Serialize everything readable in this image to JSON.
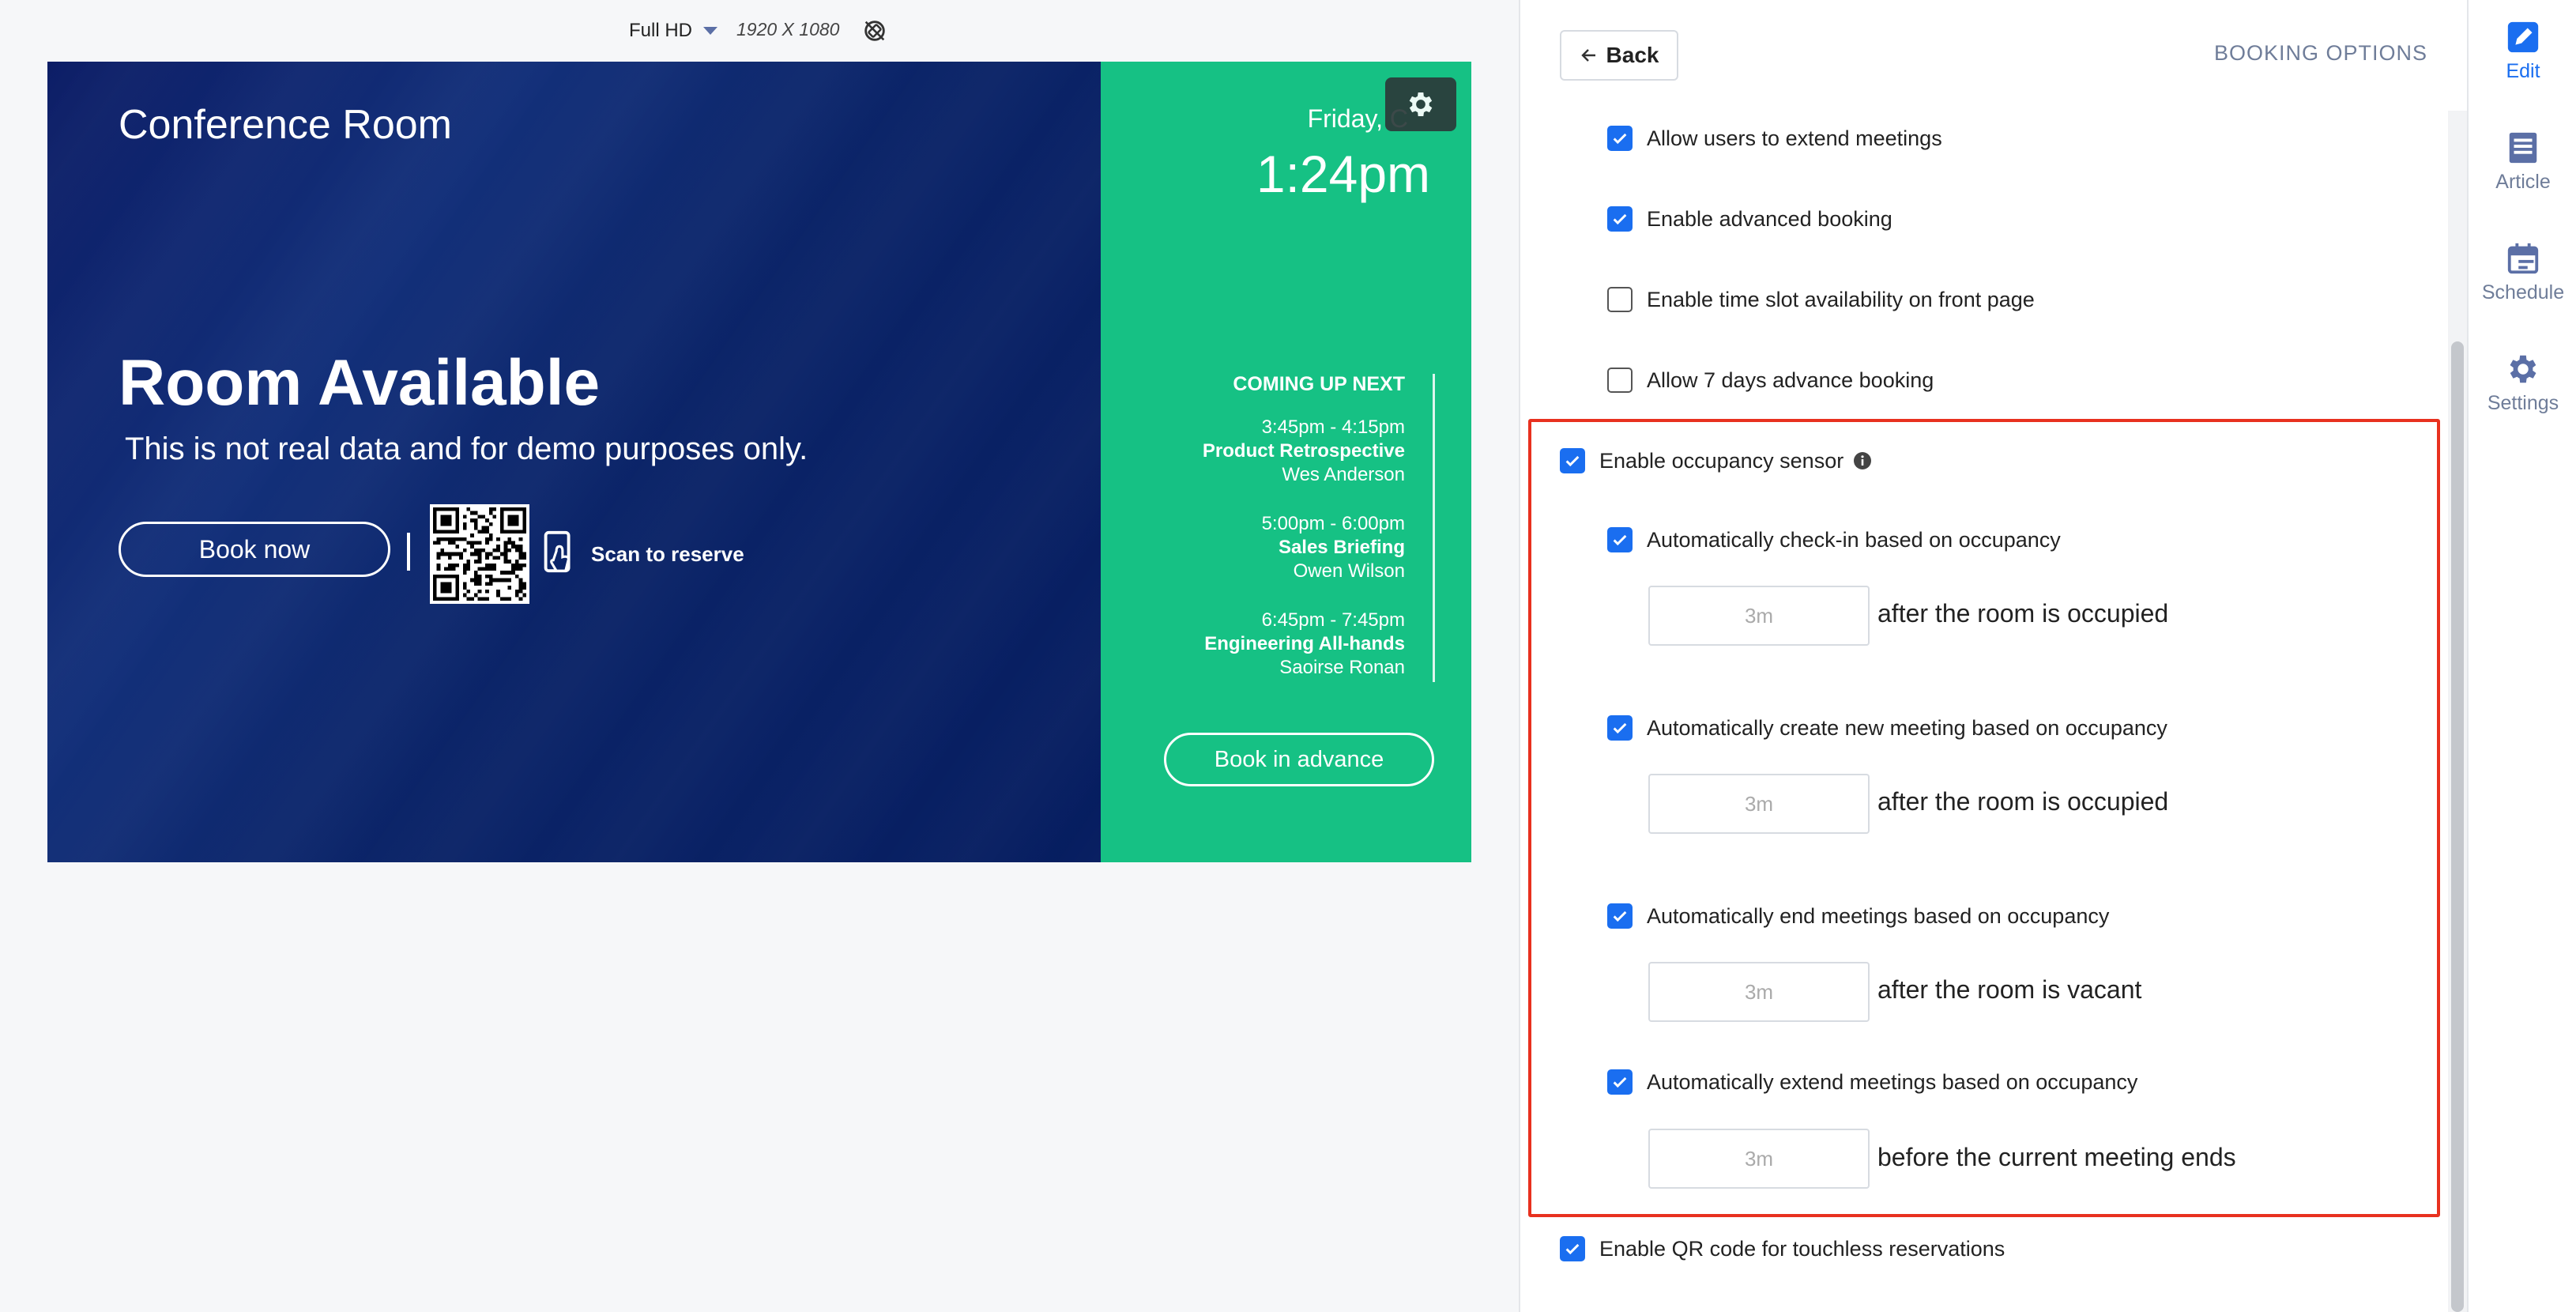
{
  "toolbar": {
    "resolution": "Full HD",
    "dimensions": "1920 X 1080"
  },
  "preview": {
    "room_name": "Conference Room",
    "status_title": "Room Available",
    "status_subtitle": "This is not real data and for demo purposes only.",
    "book_now": "Book now",
    "scan_label": "Scan to reserve",
    "date": "Friday, C",
    "time": "1:24pm",
    "upnext_heading": "COMING UP NEXT",
    "meetings": [
      {
        "time": "3:45pm - 4:15pm",
        "title": "Product Retrospective",
        "host": "Wes Anderson"
      },
      {
        "time": "5:00pm - 6:00pm",
        "title": "Sales Briefing",
        "host": "Owen Wilson"
      },
      {
        "time": "6:45pm - 7:45pm",
        "title": "Engineering All-hands",
        "host": "Saoirse Ronan"
      }
    ],
    "book_advance": "Book in advance"
  },
  "settings": {
    "back": "Back",
    "section_title": "BOOKING OPTIONS",
    "options": [
      {
        "label": "Allow users to extend meetings",
        "checked": true
      },
      {
        "label": "Enable advanced booking",
        "checked": true
      },
      {
        "label": "Enable time slot availability on front page",
        "checked": false
      },
      {
        "label": "Allow 7 days advance booking",
        "checked": false
      },
      {
        "label": "Enable occupancy sensor",
        "checked": true
      },
      {
        "label": "Automatically check-in based on occupancy",
        "checked": true
      },
      {
        "label": "Automatically create new meeting based on occupancy",
        "checked": true
      },
      {
        "label": "Automatically end meetings based on occupancy",
        "checked": true
      },
      {
        "label": "Automatically extend meetings based on occupancy",
        "checked": true
      },
      {
        "label": "Enable QR code for touchless reservations",
        "checked": true
      }
    ],
    "durations": [
      {
        "placeholder": "3m",
        "suffix": "after the room is occupied"
      },
      {
        "placeholder": "3m",
        "suffix": "after the room is occupied"
      },
      {
        "placeholder": "3m",
        "suffix": "after the room is vacant"
      },
      {
        "placeholder": "3m",
        "suffix": "before the current meeting ends"
      }
    ]
  },
  "nav": {
    "items": [
      {
        "label": "Edit",
        "icon": "pencil-icon",
        "active": true
      },
      {
        "label": "Article",
        "icon": "article-icon",
        "active": false
      },
      {
        "label": "Schedule",
        "icon": "calendar-icon",
        "active": false
      },
      {
        "label": "Settings",
        "icon": "gear-icon",
        "active": false
      }
    ]
  },
  "colors": {
    "accent": "#1a6ef0",
    "preview_blue": "#0c1d66",
    "preview_green": "#16c184",
    "highlight": "#e8311f"
  }
}
